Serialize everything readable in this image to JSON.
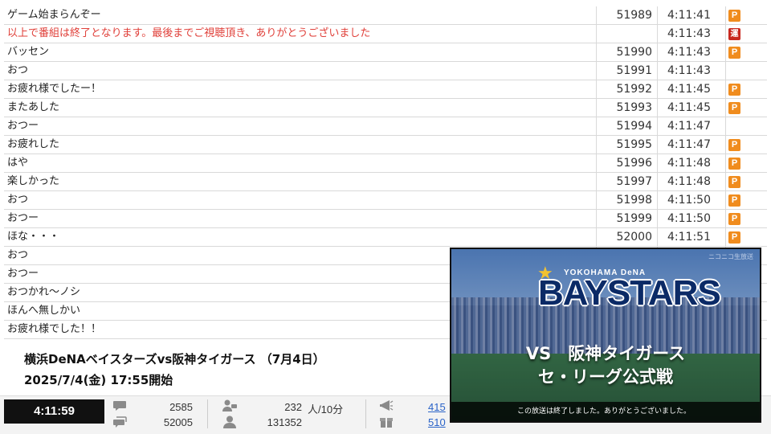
{
  "comments": [
    {
      "text": "ゲーム始まらんぞー",
      "no": "51989",
      "time": "4:11:41",
      "badge": "P",
      "operator": false
    },
    {
      "text": "以上で番組は終了となります。最後までご視聴頂き、ありがとうございました",
      "no": "",
      "time": "4:11:43",
      "badge": "運",
      "operator": true
    },
    {
      "text": "バッセン",
      "no": "51990",
      "time": "4:11:43",
      "badge": "P",
      "operator": false
    },
    {
      "text": "おつ",
      "no": "51991",
      "time": "4:11:43",
      "badge": "",
      "operator": false
    },
    {
      "text": "お疲れ様でしたー！",
      "no": "51992",
      "time": "4:11:45",
      "badge": "P",
      "operator": false
    },
    {
      "text": "またあした",
      "no": "51993",
      "time": "4:11:45",
      "badge": "P",
      "operator": false
    },
    {
      "text": "おつー",
      "no": "51994",
      "time": "4:11:47",
      "badge": "",
      "operator": false
    },
    {
      "text": "お疲れした",
      "no": "51995",
      "time": "4:11:47",
      "badge": "P",
      "operator": false
    },
    {
      "text": "はや",
      "no": "51996",
      "time": "4:11:48",
      "badge": "P",
      "operator": false
    },
    {
      "text": "楽しかった",
      "no": "51997",
      "time": "4:11:48",
      "badge": "P",
      "operator": false
    },
    {
      "text": "おつ",
      "no": "51998",
      "time": "4:11:50",
      "badge": "P",
      "operator": false
    },
    {
      "text": "おつー",
      "no": "51999",
      "time": "4:11:50",
      "badge": "P",
      "operator": false
    },
    {
      "text": "ほな・・・",
      "no": "52000",
      "time": "4:11:51",
      "badge": "P",
      "operator": false
    },
    {
      "text": "おつ",
      "no": "",
      "time": "",
      "badge": "",
      "operator": false
    },
    {
      "text": "おつー",
      "no": "",
      "time": "",
      "badge": "",
      "operator": false
    },
    {
      "text": "おつかれ～ノシ",
      "no": "",
      "time": "",
      "badge": "",
      "operator": false
    },
    {
      "text": "ほんへ無しかい",
      "no": "",
      "time": "",
      "badge": "",
      "operator": false
    },
    {
      "text": "お疲れ様でした！！",
      "no": "",
      "time": "",
      "badge": "",
      "operator": false
    }
  ],
  "program": {
    "title": "横浜DeNAベイスターズvs阪神タイガース （7月4日）",
    "start": "2025/7/4(金) 17:55開始"
  },
  "status": {
    "elapsed": "4:11:59",
    "comments_visible": "2585",
    "comments_total": "52005",
    "viewers_per_10min": "232",
    "viewers_unit": "人/10分",
    "viewers_total": "131352",
    "ad_points": "415",
    "gift_points": "510"
  },
  "video": {
    "watermark": "ニコニコ生放送",
    "brand_small": "YOKOHAMA DeNA",
    "brand_big": "BAYSTARS",
    "vs_line": "VS　阪神タイガース",
    "league_line": "セ・リーグ公式戦",
    "caption": "この放送は終了しました。ありがとうございました。"
  },
  "colors": {
    "premium_badge": "#f08c1e",
    "operator_badge": "#c8281e",
    "operator_text": "#e0403a",
    "link": "#2a63c8"
  }
}
